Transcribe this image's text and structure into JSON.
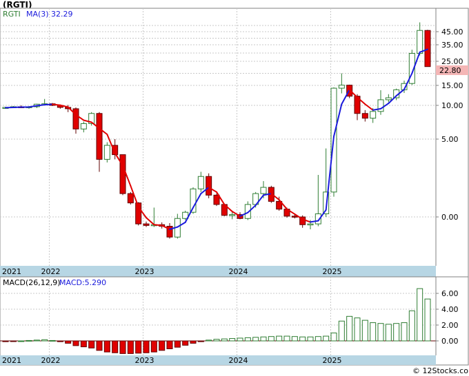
{
  "title": "(RGTI)",
  "watermark": "© 12Stocks.com",
  "price_panel": {
    "legend_ticker": "RGTI",
    "legend_ma_label": "MA(3)",
    "legend_ma_value": "32.29",
    "last_price_label": "22.80",
    "y_ticks": [
      "45.00",
      "35.00",
      "25.00",
      "15.00",
      "10.00",
      "5.00",
      "0.00"
    ],
    "x_labels": [
      "2021",
      "2022",
      "2023",
      "2024",
      "2025"
    ]
  },
  "macd_panel": {
    "legend_label": "MACD(26,12,9)",
    "legend_value_label": "MACD:5.290",
    "y_ticks": [
      "6.00",
      "4.00",
      "2.00",
      "0.00"
    ],
    "x_labels": [
      "2021",
      "2022",
      "2023",
      "2024",
      "2025"
    ]
  },
  "colors": {
    "up_candle": "#2e7d32",
    "down_candle": "#e00000",
    "ma_up": "#1a1adc",
    "ma_down": "#e00000",
    "axis_strip": "#b7d6e4",
    "last_price_box": "#f4b6b6"
  },
  "chart_data": {
    "type": "candlestick",
    "y_scale": "non-linear (as labeled)",
    "candles": [
      {
        "o": 9.6,
        "h": 9.8,
        "l": 9.5,
        "c": 9.7
      },
      {
        "o": 9.7,
        "h": 9.9,
        "l": 9.6,
        "c": 9.8
      },
      {
        "o": 9.8,
        "h": 10.0,
        "l": 9.6,
        "c": 9.7
      },
      {
        "o": 9.7,
        "h": 9.9,
        "l": 9.5,
        "c": 9.8
      },
      {
        "o": 9.8,
        "h": 10.4,
        "l": 9.6,
        "c": 10.3
      },
      {
        "o": 10.3,
        "h": 11.6,
        "l": 10.1,
        "c": 10.4
      },
      {
        "o": 10.4,
        "h": 10.6,
        "l": 9.9,
        "c": 10.0
      },
      {
        "o": 10.0,
        "h": 10.2,
        "l": 9.5,
        "c": 9.7
      },
      {
        "o": 9.7,
        "h": 10.1,
        "l": 9.0,
        "c": 9.5
      },
      {
        "o": 9.5,
        "h": 9.7,
        "l": 5.8,
        "c": 6.5
      },
      {
        "o": 6.5,
        "h": 7.6,
        "l": 6.0,
        "c": 7.3
      },
      {
        "o": 7.3,
        "h": 9.0,
        "l": 7.0,
        "c": 8.8
      },
      {
        "o": 8.8,
        "h": 9.0,
        "l": 2.9,
        "c": 3.7
      },
      {
        "o": 3.7,
        "h": 4.8,
        "l": 3.5,
        "c": 4.6
      },
      {
        "o": 4.6,
        "h": 5.0,
        "l": 3.7,
        "c": 4.0
      },
      {
        "o": 4.0,
        "h": 4.0,
        "l": 1.4,
        "c": 1.5
      },
      {
        "o": 1.5,
        "h": 1.6,
        "l": 0.8,
        "c": 0.9
      },
      {
        "o": 0.9,
        "h": 0.95,
        "l": -0.55,
        "c": -0.45
      },
      {
        "o": -0.45,
        "h": -0.3,
        "l": -0.65,
        "c": -0.55
      },
      {
        "o": -0.55,
        "h": 0.6,
        "l": -0.65,
        "c": -0.5
      },
      {
        "o": -0.5,
        "h": -0.35,
        "l": -0.75,
        "c": -0.6
      },
      {
        "o": -0.6,
        "h": -0.4,
        "l": -1.4,
        "c": -1.3
      },
      {
        "o": -1.3,
        "h": 0.2,
        "l": -1.4,
        "c": -0.1
      },
      {
        "o": -0.1,
        "h": 0.4,
        "l": -0.2,
        "c": 0.3
      },
      {
        "o": 0.3,
        "h": 1.9,
        "l": 0.2,
        "c": 1.8
      },
      {
        "o": 1.8,
        "h": 2.9,
        "l": 1.6,
        "c": 2.6
      },
      {
        "o": 2.6,
        "h": 2.8,
        "l": 1.2,
        "c": 1.4
      },
      {
        "o": 1.4,
        "h": 1.5,
        "l": 0.7,
        "c": 0.8
      },
      {
        "o": 0.8,
        "h": 0.85,
        "l": 0.05,
        "c": 0.1
      },
      {
        "o": 0.1,
        "h": 0.4,
        "l": -0.15,
        "c": 0.15
      },
      {
        "o": 0.15,
        "h": 0.3,
        "l": -0.15,
        "c": -0.1
      },
      {
        "o": -0.1,
        "h": 1.0,
        "l": -0.2,
        "c": 0.8
      },
      {
        "o": 0.8,
        "h": 1.6,
        "l": 0.6,
        "c": 1.5
      },
      {
        "o": 1.5,
        "h": 2.3,
        "l": 1.2,
        "c": 1.9
      },
      {
        "o": 1.9,
        "h": 2.0,
        "l": 0.9,
        "c": 1.0
      },
      {
        "o": 1.0,
        "h": 1.3,
        "l": 0.4,
        "c": 0.5
      },
      {
        "o": 0.5,
        "h": 0.6,
        "l": -0.05,
        "c": 0.05
      },
      {
        "o": 0.05,
        "h": 0.2,
        "l": -0.1,
        "c": 0.0
      },
      {
        "o": 0.0,
        "h": 0.1,
        "l": -0.7,
        "c": -0.5
      },
      {
        "o": -0.5,
        "h": -0.2,
        "l": -0.8,
        "c": -0.45
      },
      {
        "o": -0.45,
        "h": 2.7,
        "l": -0.6,
        "c": 0.2
      },
      {
        "o": 0.2,
        "h": 4.4,
        "l": 0.0,
        "c": 1.6
      },
      {
        "o": 1.6,
        "h": 14.5,
        "l": 1.3,
        "c": 14.3
      },
      {
        "o": 14.3,
        "h": 20.0,
        "l": 13.0,
        "c": 15.1
      },
      {
        "o": 15.1,
        "h": 15.3,
        "l": 11.8,
        "c": 12.3
      },
      {
        "o": 12.3,
        "h": 12.8,
        "l": 7.8,
        "c": 8.8
      },
      {
        "o": 8.8,
        "h": 9.3,
        "l": 7.6,
        "c": 8.1
      },
      {
        "o": 8.1,
        "h": 9.6,
        "l": 7.4,
        "c": 9.1
      },
      {
        "o": 9.1,
        "h": 13.8,
        "l": 8.6,
        "c": 11.4
      },
      {
        "o": 11.4,
        "h": 12.8,
        "l": 10.8,
        "c": 11.9
      },
      {
        "o": 11.9,
        "h": 14.2,
        "l": 11.3,
        "c": 13.9
      },
      {
        "o": 13.9,
        "h": 17.0,
        "l": 13.1,
        "c": 15.8
      },
      {
        "o": 15.8,
        "h": 32.0,
        "l": 15.2,
        "c": 29.8
      },
      {
        "o": 29.8,
        "h": 52.5,
        "l": 28.5,
        "c": 46.0
      },
      {
        "o": 46.0,
        "h": 46.5,
        "l": 22.8,
        "c": 22.8
      }
    ],
    "ma3": [
      9.65,
      9.7,
      9.75,
      9.75,
      9.95,
      10.15,
      10.25,
      10.05,
      9.75,
      8.6,
      7.8,
      7.5,
      6.6,
      5.7,
      4.1,
      3.3,
      2.0,
      0.65,
      -0.05,
      -0.5,
      -0.55,
      -0.8,
      -0.65,
      -0.35,
      0.6,
      1.5,
      1.9,
      1.6,
      0.8,
      0.35,
      0.05,
      0.28,
      0.75,
      1.4,
      1.5,
      1.1,
      0.5,
      0.18,
      -0.15,
      -0.33,
      -0.25,
      0.45,
      5.4,
      10.3,
      13.9,
      12.0,
      10.3,
      9.3,
      9.5,
      10.5,
      12.4,
      14.0,
      20.0,
      30.5,
      32.29
    ],
    "macd": [
      -0.1,
      -0.05,
      0.0,
      0.05,
      0.1,
      0.15,
      0.05,
      -0.1,
      -0.3,
      -0.6,
      -0.75,
      -0.9,
      -1.2,
      -1.4,
      -1.5,
      -1.6,
      -1.6,
      -1.55,
      -1.5,
      -1.4,
      -1.2,
      -1.0,
      -0.8,
      -0.55,
      -0.3,
      -0.1,
      0.1,
      0.2,
      0.25,
      0.3,
      0.35,
      0.4,
      0.45,
      0.5,
      0.55,
      0.6,
      0.6,
      0.55,
      0.5,
      0.5,
      0.55,
      0.6,
      1.0,
      2.5,
      3.1,
      2.9,
      2.6,
      2.3,
      2.2,
      2.1,
      2.2,
      2.3,
      3.8,
      6.6,
      5.29
    ],
    "price_y_ticks": [
      "45.00",
      "35.00",
      "25.00",
      "15.00",
      "10.00",
      "5.00",
      "0.00"
    ],
    "macd_y_ticks": [
      6,
      4,
      2,
      0
    ],
    "x_labels": [
      "2021",
      "2022",
      "2023",
      "2024",
      "2025"
    ]
  }
}
